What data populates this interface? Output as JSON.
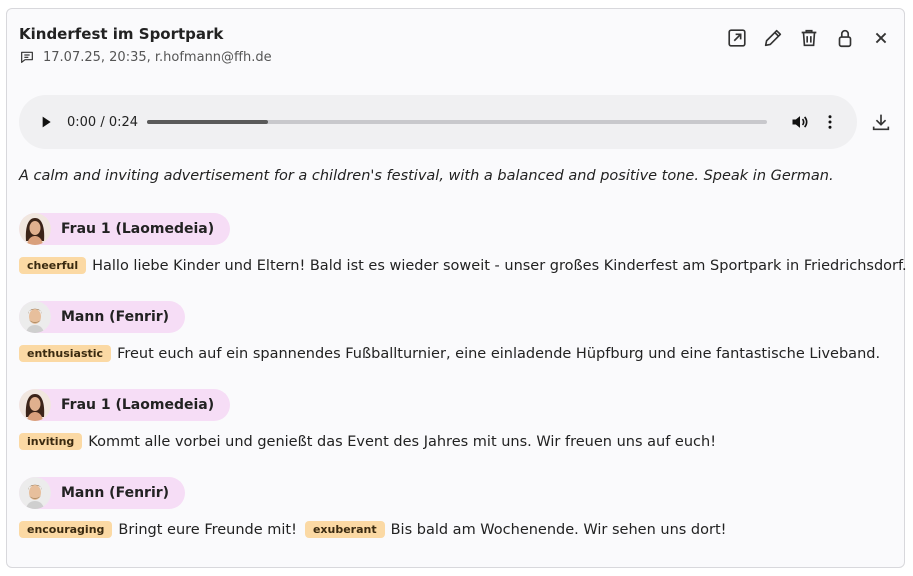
{
  "header": {
    "title": "Kinderfest im Sportpark",
    "meta": "17.07.25, 20:35, r.hofmann@ffh.de"
  },
  "player": {
    "time": "0:00 / 0:24",
    "progress": 0.195
  },
  "description": "A calm and inviting advertisement for a children's festival, with a balanced and positive tone. Speak in German.",
  "turns": [
    {
      "speaker": "Frau 1 (Laomedeia)",
      "avatar": "female",
      "segments": [
        {
          "tag": "cheerful",
          "text": "Hallo liebe Kinder und Eltern! Bald ist es wieder soweit - unser großes Kinderfest am Sportpark in Friedrichsdorf."
        }
      ]
    },
    {
      "speaker": "Mann (Fenrir)",
      "avatar": "male",
      "segments": [
        {
          "tag": "enthusiastic",
          "text": "Freut euch auf ein spannendes Fußballturnier, eine einladende Hüpfburg und eine fantastische Liveband."
        }
      ]
    },
    {
      "speaker": "Frau 1 (Laomedeia)",
      "avatar": "female",
      "segments": [
        {
          "tag": "inviting",
          "text": "Kommt alle vorbei und genießt das Event des Jahres mit uns. Wir freuen uns auf euch!"
        }
      ]
    },
    {
      "speaker": "Mann (Fenrir)",
      "avatar": "male",
      "segments": [
        {
          "tag": "encouraging",
          "text": "Bringt eure Freunde mit!"
        },
        {
          "tag": "exuberant",
          "text": "Bis bald am Wochenende. Wir sehen uns dort!"
        }
      ]
    }
  ],
  "icons": {
    "header_actions": [
      "open-external-icon",
      "pencil-icon",
      "trash-icon",
      "lock-icon",
      "close-icon"
    ],
    "meta": "chat-bubble-icon",
    "player": [
      "play-icon",
      "volume-icon",
      "more-vertical-icon"
    ],
    "download": "download-icon"
  },
  "colors": {
    "speaker_bg": "#f6ddf6",
    "tag_bg": "#fbd9a4"
  }
}
